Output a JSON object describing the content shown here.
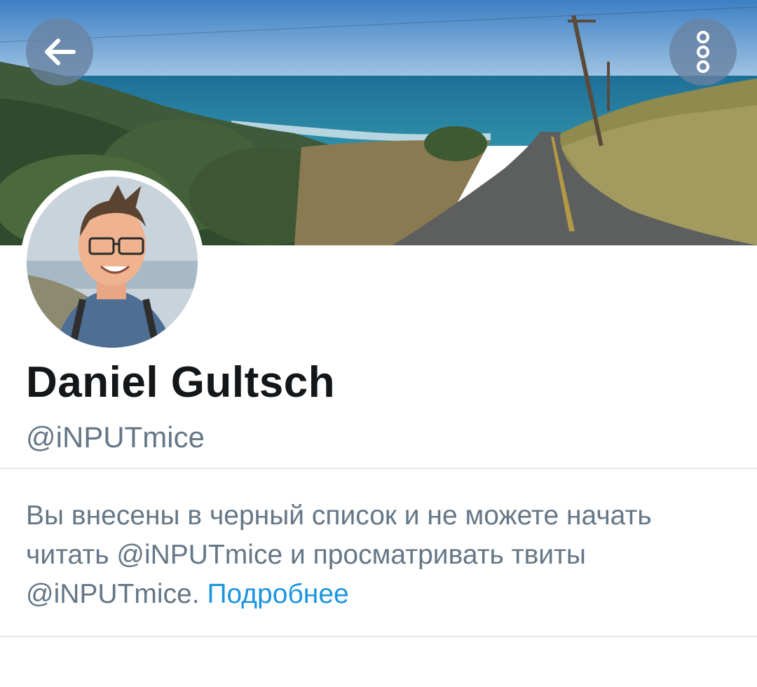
{
  "header": {
    "back_icon": "arrow-left-icon",
    "more_icon": "more-vertical-icon",
    "button_color": "#6982a0"
  },
  "profile": {
    "display_name": "Daniel Gultsch",
    "handle": "@iNPUTmice"
  },
  "blocked_notice": {
    "text": "Вы внесены в черный список и не можете начать читать @iNPUTmice и просматривать твиты @iNPUTmice.",
    "learn_more_label": "Подробнее"
  },
  "colors": {
    "name_text": "#14171a",
    "secondary_text": "#657786",
    "link": "#1b95e0",
    "divider": "#e1e8ed"
  }
}
